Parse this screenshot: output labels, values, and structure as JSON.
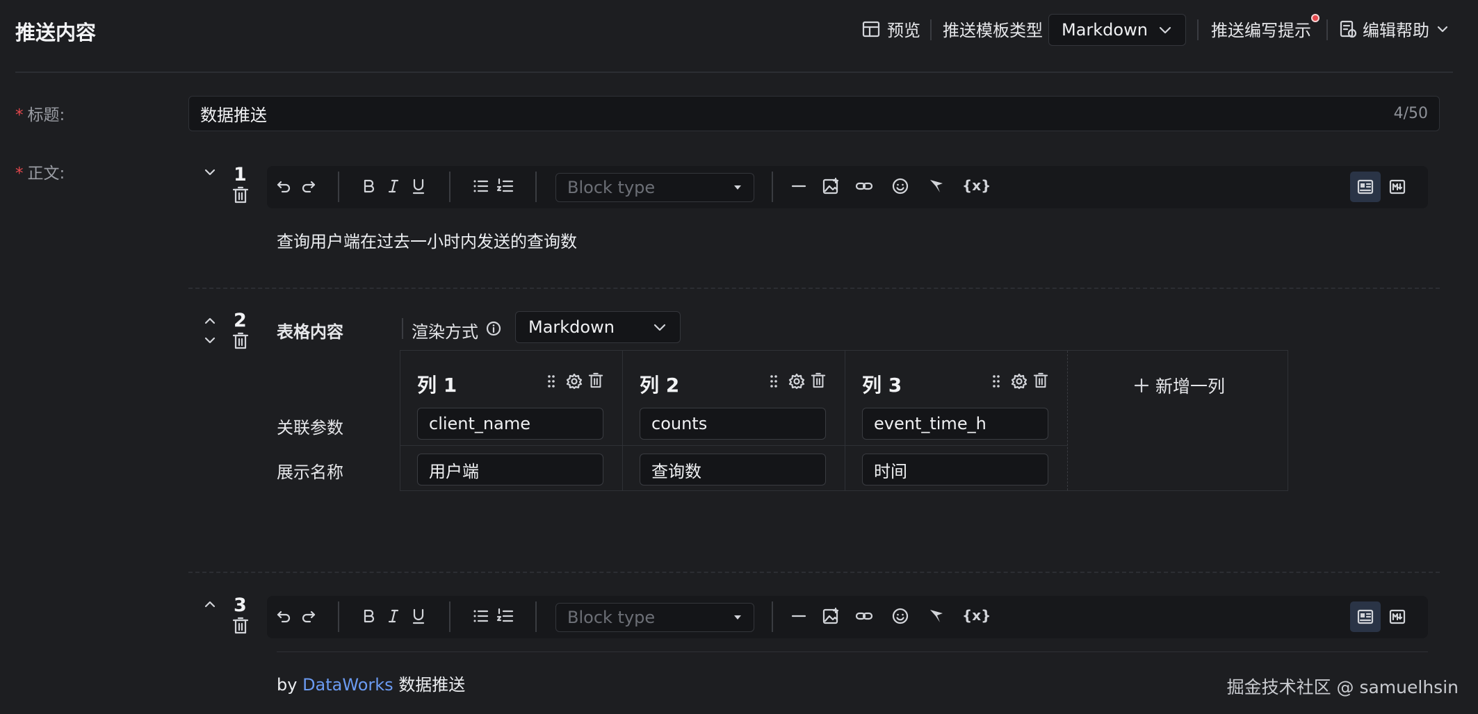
{
  "header": {
    "title": "推送内容",
    "preview_label": "预览",
    "template_type_label": "推送模板类型",
    "template_type_value": "Markdown",
    "write_tips_label": "推送编写提示",
    "edit_help_label": "编辑帮助"
  },
  "form": {
    "title_label": "标题:",
    "title_value": "数据推送",
    "title_counter": "4/50",
    "body_label": "正文:"
  },
  "blocks": [
    {
      "number": "1",
      "toolbar": {
        "block_type_placeholder": "Block type",
        "variable_label": "{x}"
      },
      "content": "查询用户端在过去一小时内发送的查询数"
    },
    {
      "number": "2",
      "label": "表格内容",
      "render_mode_label": "渲染方式",
      "render_mode_value": "Markdown",
      "row_labels": [
        "关联参数",
        "展示名称"
      ],
      "columns": [
        {
          "title": "列 1",
          "param": "client_name",
          "display": "用户端"
        },
        {
          "title": "列 2",
          "param": "counts",
          "display": "查询数"
        },
        {
          "title": "列 3",
          "param": "event_time_h",
          "display": "时间"
        }
      ],
      "add_column_label": "新增一列"
    },
    {
      "number": "3",
      "toolbar": {
        "block_type_placeholder": "Block type",
        "variable_label": "{x}"
      },
      "content_prefix": "by",
      "content_link": "DataWorks",
      "content_suffix": "数据推送"
    }
  ],
  "watermark": "掘金技术社区 @ samuelhsin",
  "colors": {
    "background": "#1d1e21",
    "input_background": "#141518",
    "required_mark": "#e5484d",
    "link": "#6b9bf2",
    "active_mode": "#2a3446"
  }
}
